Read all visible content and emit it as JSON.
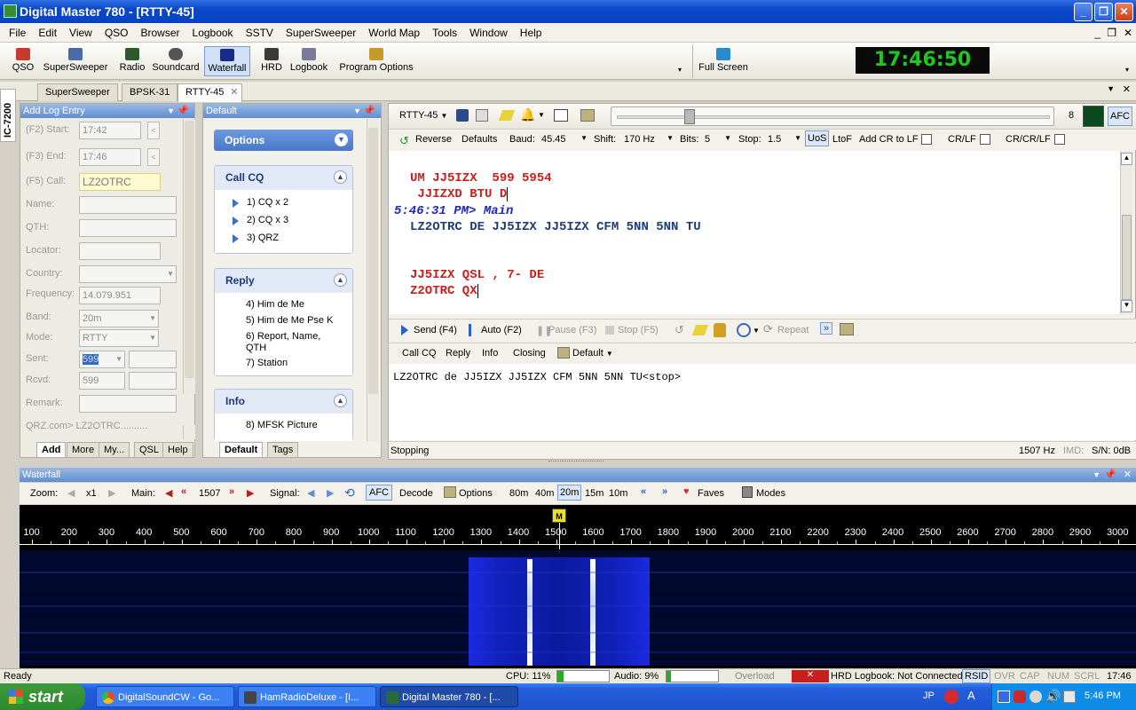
{
  "window": {
    "title": "Digital Master 780 - [RTTY-45]"
  },
  "menu": [
    "File",
    "Edit",
    "View",
    "QSO",
    "Browser",
    "Logbook",
    "SSTV",
    "SuperSweeper",
    "World Map",
    "Tools",
    "Window",
    "Help"
  ],
  "toolbar": {
    "buttons": [
      "QSO",
      "SuperSweeper",
      "Radio",
      "Soundcard",
      "Waterfall",
      "HRD",
      "Logbook",
      "Program Options"
    ],
    "full_screen": "Full Screen",
    "clock": "17:46:50"
  },
  "doc_tabs": [
    "SuperSweeper",
    "BPSK-31",
    "RTTY-45"
  ],
  "side_label": "IC-7200",
  "log_entry": {
    "title": "Add Log Entry",
    "fields": [
      {
        "label": "(F2) Start:",
        "value": "17:42"
      },
      {
        "label": "(F3) End:",
        "value": "17:46"
      },
      {
        "label": "(F5) Call:",
        "value": "LZ2OTRC"
      },
      {
        "label": "Name:",
        "value": ""
      },
      {
        "label": "QTH:",
        "value": ""
      },
      {
        "label": "Locator:",
        "value": ""
      },
      {
        "label": "Country:",
        "value": ""
      },
      {
        "label": "Frequency:",
        "value": "14.079.951"
      },
      {
        "label": "Band:",
        "value": "20m"
      },
      {
        "label": "Mode:",
        "value": "RTTY"
      },
      {
        "label": "Sent:",
        "value": "599"
      },
      {
        "label": "Rcvd:",
        "value": "599"
      },
      {
        "label": "Remark:",
        "value": ""
      }
    ],
    "qrz_text": "QRZ.com> LZ2OTRC..........",
    "tabs": [
      "Add",
      "More",
      "My...",
      "QSL",
      "Help"
    ]
  },
  "macros": {
    "title": "Default",
    "options_label": "Options",
    "groups": [
      {
        "name": "Call CQ",
        "items": [
          "1) CQ x 2",
          "2) CQ x 3",
          "3) QRZ"
        ]
      },
      {
        "name": "Reply",
        "items": [
          "4) Him de Me",
          "5) Him de Me Pse K",
          "6) Report, Name, QTH",
          "7) Station"
        ]
      },
      {
        "name": "Info",
        "items": [
          "8) MFSK Picture"
        ]
      }
    ],
    "tabs": [
      "Default",
      "Tags"
    ]
  },
  "rtty": {
    "mode": "RTTY-45",
    "tuning_value": "8",
    "afc": "AFC",
    "settings": {
      "reverse": "Reverse",
      "defaults": "Defaults",
      "baud_label": "Baud:",
      "baud": "45.45",
      "shift_label": "Shift:",
      "shift": "170 Hz",
      "bits_label": "Bits:",
      "bits": "5",
      "stop_label": "Stop:",
      "stop": "1.5",
      "uos": "UoS",
      "ltof": "LtoF",
      "add_cr": "Add CR to LF",
      "crlf": "CR/LF",
      "crcrlf": "CR/CR/LF"
    },
    "rx_lines": [
      {
        "text": "UM JJ5IZX  599 5954",
        "color": "#c81e1e"
      },
      {
        "text": " JJIZXD BTU D",
        "color": "#c81e1e"
      },
      {
        "text": "5:46:31 PM> Main",
        "color": "#1e28c8"
      },
      {
        "text": "LZ2OTRC DE JJ5IZX JJ5IZX CFM 5NN 5NN TU",
        "color": "#1e3c78"
      },
      {
        "text": "JJ5IZX QSL , 7- DE",
        "color": "#c81e1e"
      },
      {
        "text": "Z2OTRC QX",
        "color": "#c81e1e"
      }
    ],
    "tx_toolbar": [
      "Send (F4)",
      "Auto (F2)",
      "Pause (F3)",
      "Stop (F5)",
      "Repeat"
    ],
    "macro_bar": [
      "Call CQ",
      "Reply",
      "Info",
      "Closing",
      "Default"
    ],
    "tx_text": "LZ2OTRC de JJ5IZX JJ5IZX CFM 5NN 5NN TU<stop>",
    "status": "Stopping",
    "freq": "1507 Hz",
    "imd": "IMD:",
    "sn": "S/N: 0dB"
  },
  "waterfall": {
    "title": "Waterfall",
    "zoom_label": "Zoom:",
    "zoom": "x1",
    "main_label": "Main:",
    "main": "1507",
    "signal_label": "Signal:",
    "afc": "AFC",
    "decode": "Decode",
    "options": "Options",
    "bands": [
      "80m",
      "40m",
      "20m",
      "15m",
      "10m"
    ],
    "faves": "Faves",
    "modes": "Modes",
    "marker": "M",
    "ruler": [
      "100",
      "200",
      "300",
      "400",
      "500",
      "600",
      "700",
      "800",
      "900",
      "1000",
      "1100",
      "1200",
      "1300",
      "1400",
      "1500",
      "1600",
      "1700",
      "1800",
      "1900",
      "2000",
      "2100",
      "2200",
      "2300",
      "2400",
      "2500",
      "2600",
      "2700",
      "2800",
      "2900",
      "3000"
    ]
  },
  "statusbar": {
    "ready": "Ready",
    "cpu": "CPU: 11%",
    "audio": "Audio: 9%",
    "overload": "Overload",
    "hrd_logbook": "HRD Logbook: Not Connected",
    "rsid": "RSID",
    "ovr": "OVR",
    "cap": "CAP",
    "num": "NUM",
    "scrl": "SCRL",
    "time": "17:46"
  },
  "taskbar": {
    "start": "start",
    "tasks": [
      "DigitalSoundCW - Go...",
      "HamRadioDeluxe - [I...",
      "Digital Master 780 - [..."
    ],
    "lang": "JP",
    "clock": "5:46 PM"
  }
}
